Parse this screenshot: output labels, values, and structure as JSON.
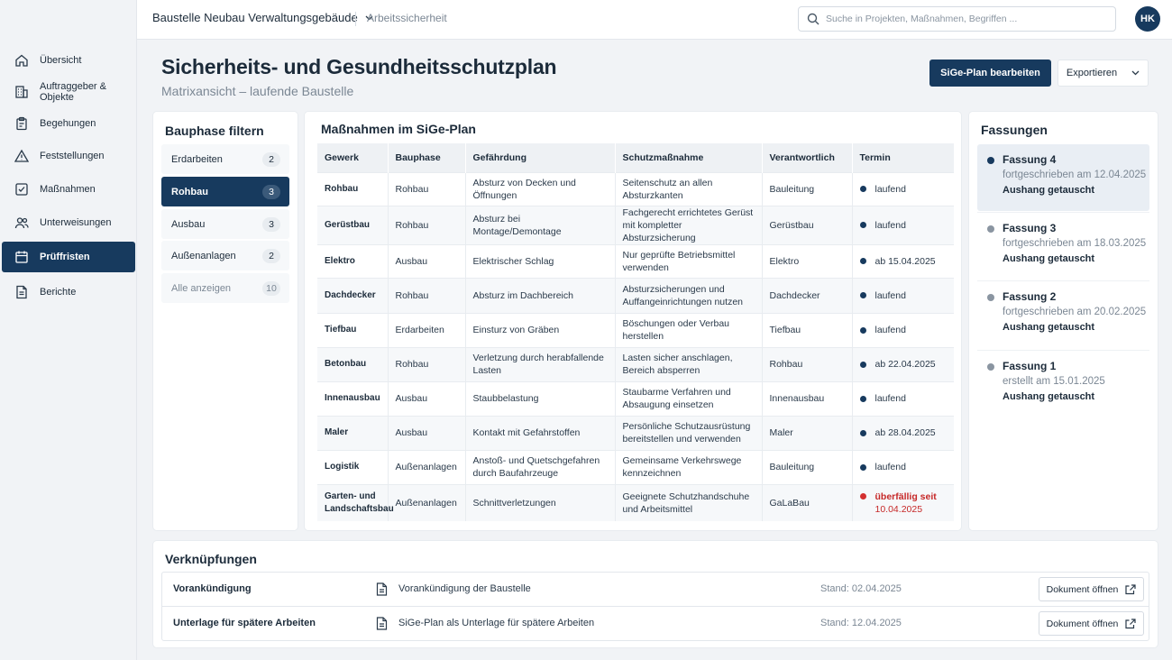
{
  "nav": {
    "items": [
      {
        "label": "Übersicht",
        "icon": "home-icon"
      },
      {
        "label": "Auftraggeber & Objekte",
        "icon": "building-icon"
      },
      {
        "label": "Begehungen",
        "icon": "clipboard-icon"
      },
      {
        "label": "Feststellungen",
        "icon": "warning-icon"
      },
      {
        "label": "Maßnahmen",
        "icon": "checkbox-icon"
      },
      {
        "label": "Unterweisungen",
        "icon": "users-icon"
      },
      {
        "label": "Prüffristen",
        "icon": "calendar-icon"
      },
      {
        "label": "Berichte",
        "icon": "document-icon"
      }
    ],
    "active_index": 6
  },
  "topbar": {
    "project": "Baustelle Neubau Verwaltungsgebäude",
    "section": "Arbeitssicherheit",
    "search_placeholder": "Suche in Projekten, Maßnahmen, Begriffen ...",
    "avatar_initials": "HK"
  },
  "header": {
    "title": "Sicherheits- und Gesundheitsschutzplan",
    "subtitle": "Matrixansicht – laufende Baustelle",
    "edit_button": "SiGe-Plan bearbeiten",
    "export_button": "Exportieren"
  },
  "filter": {
    "title": "Bauphase filtern",
    "items": [
      {
        "label": "Erdarbeiten",
        "count": "2"
      },
      {
        "label": "Rohbau",
        "count": "3"
      },
      {
        "label": "Ausbau",
        "count": "3"
      },
      {
        "label": "Außenanlagen",
        "count": "2"
      },
      {
        "label": "Alle anzeigen",
        "count": "10"
      }
    ],
    "active_index": 1
  },
  "table": {
    "title": "Maßnahmen im SiGe-Plan",
    "columns": [
      "Gewerk",
      "Bauphase",
      "Gefährdung",
      "Schutzmaßnahme",
      "Verantwortlich",
      "Termin"
    ],
    "rows": [
      {
        "gewerk": "Rohbau",
        "bauphase": "Rohbau",
        "gefaehrdung": "Absturz von Decken und Öffnungen",
        "schutz": "Seitenschutz an allen Absturzkanten",
        "verantwortlich": "Bauleitung",
        "termin": "laufend",
        "termin2": "",
        "overdue": false
      },
      {
        "gewerk": "Gerüstbau",
        "bauphase": "Rohbau",
        "gefaehrdung": "Absturz bei Montage/Demontage",
        "schutz": "Fachgerecht errichtetes Gerüst mit kompletter Absturzsicherung",
        "verantwortlich": "Gerüstbau",
        "termin": "laufend",
        "termin2": "",
        "overdue": false
      },
      {
        "gewerk": "Elektro",
        "bauphase": "Ausbau",
        "gefaehrdung": "Elektrischer Schlag",
        "schutz": "Nur geprüfte Betriebsmittel verwenden",
        "verantwortlich": "Elektro",
        "termin": "ab 15.04.2025",
        "termin2": "",
        "overdue": false
      },
      {
        "gewerk": "Dachdecker",
        "bauphase": "Rohbau",
        "gefaehrdung": "Absturz im Dachbereich",
        "schutz": "Absturzsicherungen und Auffangeinrichtungen nutzen",
        "verantwortlich": "Dachdecker",
        "termin": "laufend",
        "termin2": "",
        "overdue": false
      },
      {
        "gewerk": "Tiefbau",
        "bauphase": "Erdarbeiten",
        "gefaehrdung": "Einsturz von Gräben",
        "schutz": "Böschungen oder Verbau herstellen",
        "verantwortlich": "Tiefbau",
        "termin": "laufend",
        "termin2": "",
        "overdue": false
      },
      {
        "gewerk": "Betonbau",
        "bauphase": "Rohbau",
        "gefaehrdung": "Verletzung durch herabfallende Lasten",
        "schutz": "Lasten sicher anschlagen, Bereich absperren",
        "verantwortlich": "Rohbau",
        "termin": "ab 22.04.2025",
        "termin2": "",
        "overdue": false
      },
      {
        "gewerk": "Innenausbau",
        "bauphase": "Ausbau",
        "gefaehrdung": "Staubbelastung",
        "schutz": "Staubarme Verfahren und Absaugung einsetzen",
        "verantwortlich": "Innenausbau",
        "termin": "laufend",
        "termin2": "",
        "overdue": false
      },
      {
        "gewerk": "Maler",
        "bauphase": "Ausbau",
        "gefaehrdung": "Kontakt mit Gefahrstoffen",
        "schutz": "Persönliche Schutzausrüstung bereitstellen und verwenden",
        "verantwortlich": "Maler",
        "termin": "ab 28.04.2025",
        "termin2": "",
        "overdue": false
      },
      {
        "gewerk": "Logistik",
        "bauphase": "Außenanlagen",
        "gefaehrdung": "Anstoß- und Quetschgefahren durch Baufahrzeuge",
        "schutz": "Gemeinsame Verkehrswege kennzeichnen",
        "verantwortlich": "Bauleitung",
        "termin": "laufend",
        "termin2": "",
        "overdue": false
      },
      {
        "gewerk": "Garten- und Landschaftsbau",
        "bauphase": "Außenanlagen",
        "gefaehrdung": "Schnittverletzungen",
        "schutz": "Geeignete Schutzhandschuhe und Arbeitsmittel",
        "verantwortlich": "GaLaBau",
        "termin": "überfällig seit",
        "termin2": "10.04.2025",
        "overdue": true
      }
    ]
  },
  "versions": {
    "title": "Fassungen",
    "items": [
      {
        "title": "Fassung 4",
        "date": "fortgeschrieben am 12.04.2025",
        "action": "Aushang getauscht"
      },
      {
        "title": "Fassung 3",
        "date": "fortgeschrieben am 18.03.2025",
        "action": "Aushang getauscht"
      },
      {
        "title": "Fassung 2",
        "date": "fortgeschrieben am 20.02.2025",
        "action": "Aushang getauscht"
      },
      {
        "title": "Fassung 1",
        "date": "erstellt am 15.01.2025",
        "action": "Aushang getauscht"
      }
    ],
    "active_index": 0
  },
  "links": {
    "title": "Verknüpfungen",
    "rows": [
      {
        "name": "Vorankündigung",
        "doc": "Vorankündigung der Baustelle",
        "status": "Stand: 02.04.2025",
        "button": "Dokument öffnen"
      },
      {
        "name": "Unterlage für spätere Arbeiten",
        "doc": "SiGe-Plan als Unterlage für spätere Arbeiten",
        "status": "Stand: 12.04.2025",
        "button": "Dokument öffnen"
      }
    ]
  },
  "colors": {
    "primary": "#173a5e",
    "overdue": "#d32f2f",
    "background": "#f1f3f6"
  }
}
